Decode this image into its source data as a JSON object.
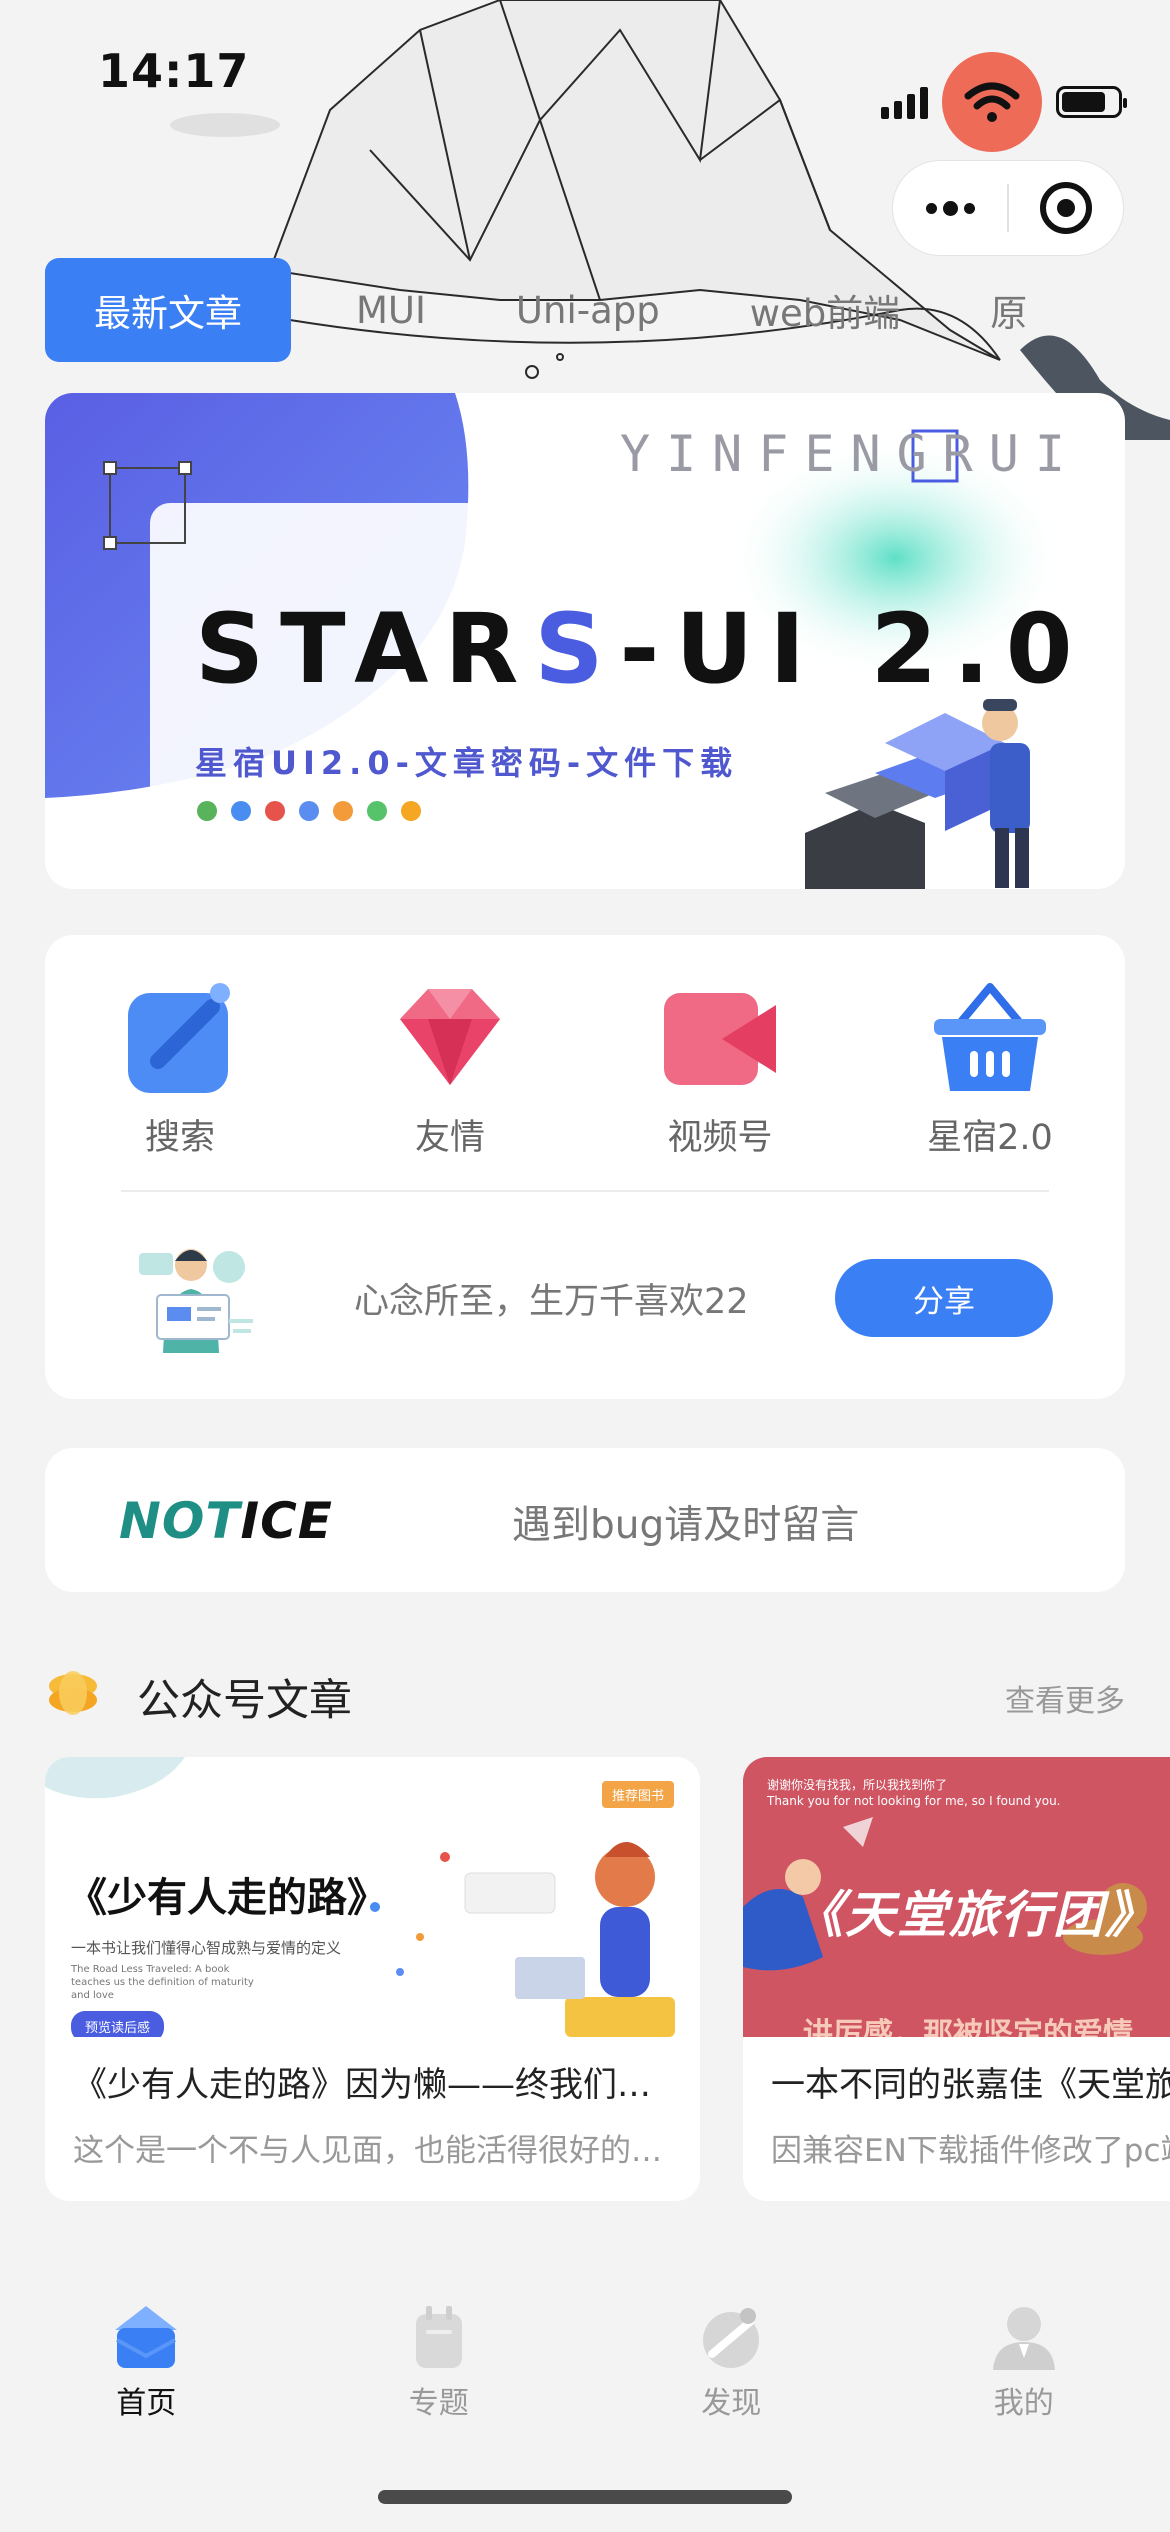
{
  "status_bar": {
    "time": "14:17"
  },
  "tabs": [
    "最新文章",
    "MUI",
    "Uni-app",
    "web前端",
    "原"
  ],
  "banner": {
    "brand": "YINFENGRUI",
    "title_pre": "STAR",
    "title_s": "S",
    "title_post": "-UI 2.0",
    "subtitle": "星宿UI2.0-文章密码-文件下载"
  },
  "grid": [
    {
      "label": "搜索",
      "icon": "edit-icon"
    },
    {
      "label": "友情",
      "icon": "gem-icon"
    },
    {
      "label": "视频号",
      "icon": "video-icon"
    },
    {
      "label": "星宿2.0",
      "icon": "basket-icon"
    }
  ],
  "share": {
    "text": "心念所至，生万千喜欢22",
    "button": "分享"
  },
  "notice": {
    "logo_n": "NOT",
    "logo_rest": "ICE",
    "text": "遇到bug请及时留言"
  },
  "section": {
    "title": "公众号文章",
    "more": "查看更多"
  },
  "articles": [
    {
      "thumb_title": "《少有人走的路》",
      "thumb_line1": "一本书让我们懂得心智成熟与爱情的定义",
      "thumb_line2": "The Road Less Traveled: A book teaches us the definition of maturity and love",
      "thumb_tag": "推荐图书",
      "thumb_pill": "预览读后感",
      "title": "《少有人走的路》因为懒——终我们一生",
      "desc": "这个是一个不与人见面，也能活得很好的时代"
    },
    {
      "thumb_top1": "谢谢你没有找我，所以我找到你了",
      "thumb_top2": "Thank you for not looking for me, so I found you.",
      "thumb_title": "《天堂旅行团》",
      "thumb_sub": "讲厉感，那被坚定的爱情",
      "title": "一本不同的张嘉佳《天堂旅行团》",
      "desc": "因兼容EN下载插件修改了pc端"
    }
  ],
  "tabbar": [
    {
      "label": "首页",
      "icon": "home-icon",
      "active": true
    },
    {
      "label": "专题",
      "icon": "topic-icon",
      "active": false
    },
    {
      "label": "发现",
      "icon": "discover-icon",
      "active": false
    },
    {
      "label": "我的",
      "icon": "user-icon",
      "active": false
    }
  ],
  "colors": {
    "primary": "#3b7ff5",
    "background": "#f3f3f4",
    "status_accent": "#ee6b57"
  }
}
